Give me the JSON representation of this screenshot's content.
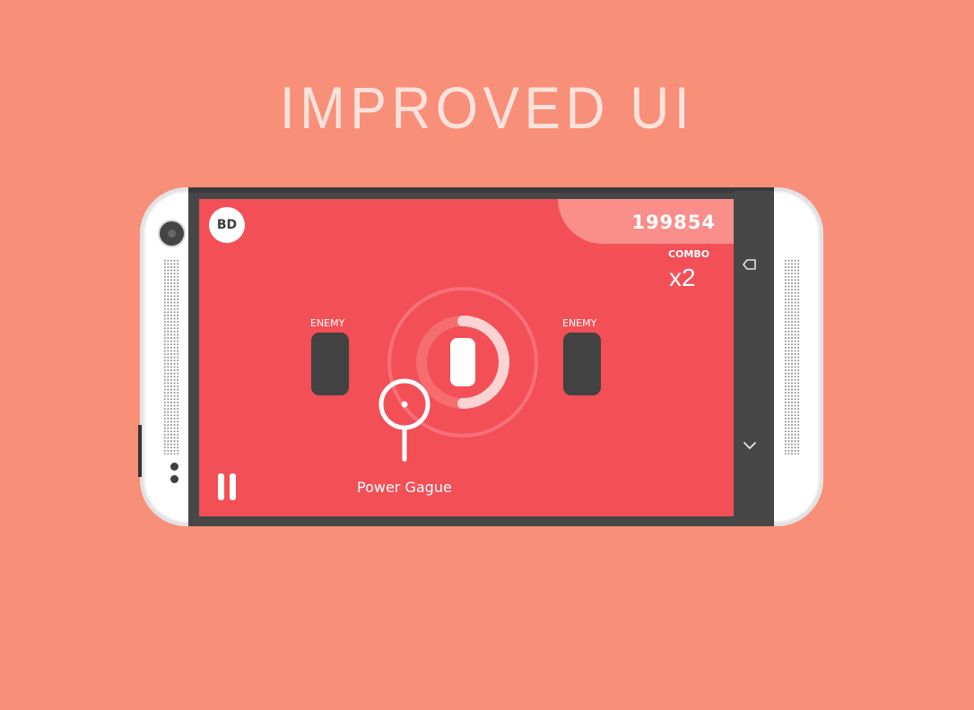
{
  "headline": "IMPROVED UI",
  "hud": {
    "score": "199854",
    "combo_label": "COMBO",
    "combo_value": "x2",
    "avatar_initials": "BD"
  },
  "enemies": [
    {
      "label": "ENEMY"
    },
    {
      "label": "ENEMY"
    }
  ],
  "power_gauge": {
    "label": "Power Gague"
  },
  "nav": {
    "back_icon": "back-arrow-icon",
    "down_icon": "chevron-down-icon"
  },
  "colors": {
    "background": "#f88f79",
    "screen": "#f24f56",
    "score_panel": "#f98e8a",
    "enemy": "#424242",
    "accent": "#ffffff"
  }
}
